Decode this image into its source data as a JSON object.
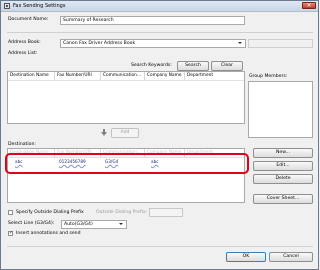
{
  "window": {
    "title": "Fax Sending Settings",
    "close_glyph": "✕"
  },
  "document_name": {
    "label": "Document Name:",
    "value": "Summary of Research"
  },
  "address_book": {
    "label": "Address Book:",
    "value": "Canon Fax Driver Address Book"
  },
  "address_list": {
    "label": "Address List:",
    "search_label": "Search Keywords:",
    "search_value": "",
    "search_button": "Search",
    "clear_button": "Clear",
    "columns": [
      "Destination Name",
      "Fax Number/URI",
      "Communication...",
      "Company Name",
      "Department"
    ]
  },
  "group_members": {
    "label": "Group Members:"
  },
  "add_button": {
    "label": "Add",
    "icon": "arrow-down-icon"
  },
  "destination": {
    "label": "Destination:",
    "columns": [
      "Destination Name",
      "Fax Number/URI",
      "Communication...",
      "Company Name",
      "Department"
    ],
    "rows": [
      {
        "name": "abc",
        "number": "0123456789",
        "mode": "G3/G4",
        "company": "abc"
      }
    ],
    "highlight_color": "#e2001a"
  },
  "side_buttons": {
    "new": "New...",
    "edit": "Edit...",
    "delete": "Delete",
    "cover_sheet": "Cover Sheet..."
  },
  "outside_dialing": {
    "checkbox_label": "Specify Outside Dialing Prefix",
    "checked": false,
    "prefix_label": "Outside Dialing Prefix:",
    "prefix_value": ""
  },
  "select_line": {
    "label": "Select Line (G3/G4):",
    "value": "Auto(G3/G4)"
  },
  "insert_annotations": {
    "label": "Insert annotations and send",
    "checked": true
  },
  "footer": {
    "ok": "OK",
    "cancel": "Cancel"
  }
}
